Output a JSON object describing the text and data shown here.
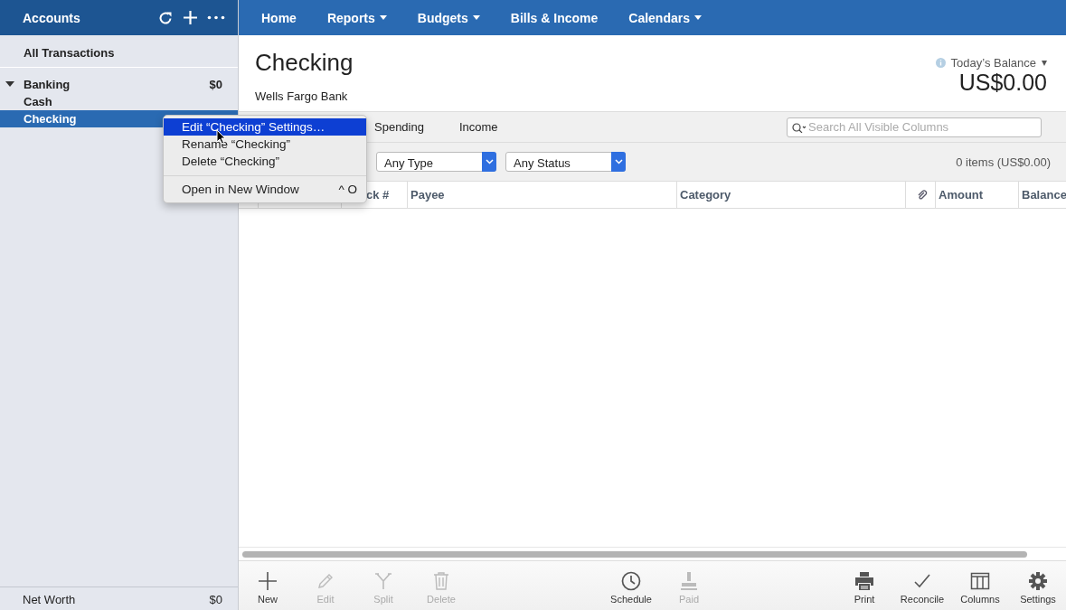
{
  "sidebar": {
    "title": "Accounts",
    "all_transactions": "All Transactions",
    "groups": [
      {
        "name": "Banking",
        "total": "$0",
        "expanded": true,
        "accounts": [
          {
            "name": "Cash",
            "selected": false
          },
          {
            "name": "Checking",
            "selected": true
          }
        ]
      }
    ],
    "net_worth": {
      "label": "Net Worth",
      "value": "$0"
    }
  },
  "nav": [
    {
      "label": "Home",
      "dropdown": false
    },
    {
      "label": "Reports",
      "dropdown": true
    },
    {
      "label": "Budgets",
      "dropdown": true
    },
    {
      "label": "Bills & Income",
      "dropdown": false
    },
    {
      "label": "Calendars",
      "dropdown": true
    }
  ],
  "account": {
    "name": "Checking",
    "bank": "Wells Fargo Bank",
    "balance_label": "Today’s Balance",
    "balance": "US$0.00"
  },
  "tabs": [
    {
      "label": "Spending",
      "selected": false
    },
    {
      "label": "Income",
      "selected": false
    }
  ],
  "search": {
    "placeholder": "Search All Visible Columns"
  },
  "filters": [
    {
      "value": "Any Type"
    },
    {
      "value": "Any Status"
    }
  ],
  "summary": "0 items (US$0.00)",
  "columns": [
    {
      "kind": "text",
      "label": "ck #"
    },
    {
      "kind": "text",
      "label": "Payee"
    },
    {
      "kind": "text",
      "label": "Category"
    },
    {
      "kind": "attachment"
    },
    {
      "kind": "text",
      "label": "Amount"
    },
    {
      "kind": "text",
      "label": "Balance"
    }
  ],
  "context_menu": [
    {
      "label": "Edit “Checking” Settings…",
      "selected": true,
      "separator_before": false
    },
    {
      "label": "Rename “Checking”",
      "selected": false,
      "separator_before": false
    },
    {
      "label": "Delete “Checking”",
      "selected": false,
      "separator_before": false
    },
    {
      "label": "Open in New Window",
      "selected": false,
      "separator_before": true,
      "shortcut": "^ O"
    }
  ],
  "toolbar": [
    {
      "label": "New",
      "disabled": false
    },
    {
      "label": "Edit",
      "disabled": true
    },
    {
      "label": "Split",
      "disabled": true
    },
    {
      "label": "Delete",
      "disabled": true
    },
    {
      "label": "Schedule",
      "disabled": false
    },
    {
      "label": "Paid",
      "disabled": true
    },
    {
      "label": "Print",
      "disabled": false
    },
    {
      "label": "Reconcile",
      "disabled": false
    },
    {
      "label": "Columns",
      "disabled": false
    },
    {
      "label": "Settings",
      "disabled": false
    }
  ]
}
